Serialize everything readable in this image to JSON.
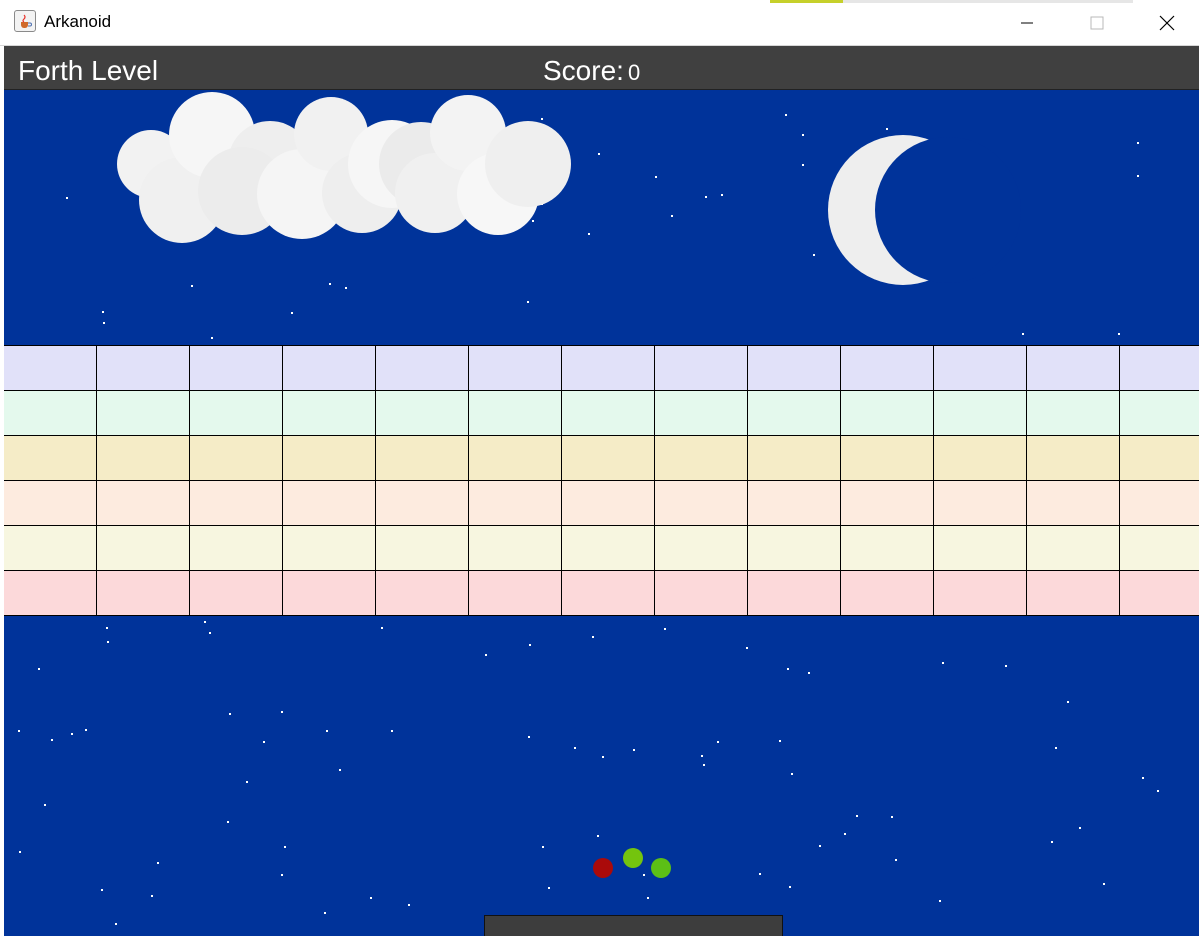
{
  "window": {
    "title": "Arkanoid",
    "icon": "java-cup-icon",
    "controls": [
      "minimize-icon",
      "maximize-icon",
      "close-icon"
    ]
  },
  "hud": {
    "level_name": "Forth Level",
    "score_label": "Score:",
    "score_value": "0"
  },
  "colors": {
    "background": "#00339a",
    "hud_background": "#404040",
    "cloud": "#f2f2f2",
    "moon": "#eeeeee",
    "star": "#ffffff",
    "paddle": "#3d3d3d",
    "block_rows": [
      "#e1e1f9",
      "#e4f9ed",
      "#f5ecc7",
      "#fdebdf",
      "#f7f6e0",
      "#fcd9da"
    ]
  },
  "blocks": {
    "rows": 6,
    "columns": 13
  },
  "balls": [
    {
      "color": "#aa0a0a"
    },
    {
      "color": "#74c40e"
    },
    {
      "color": "#5cbf16"
    }
  ]
}
